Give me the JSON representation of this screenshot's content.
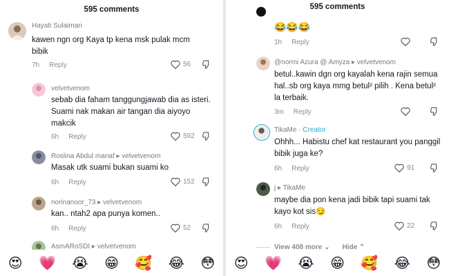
{
  "left": {
    "header": "595 comments",
    "comments": [
      {
        "user": "Hayati Sulaiman",
        "text": "kawen ngn org Kaya tp kena msk pulak mcm bibik",
        "time": "7h",
        "reply": "Reply",
        "likes": "56"
      },
      {
        "user": "velvetvenom",
        "text": "sebab dia faham tanggungjawab dia as isteri. Suami nak makan air tangan dia aiyoyo makcik",
        "time": "6h",
        "reply": "Reply",
        "likes": "592"
      },
      {
        "user": "Roslina Abdul manaf ▸ velvetvenom",
        "text": "Masak utk suami bukan suami ko",
        "time": "6h",
        "reply": "Reply",
        "likes": "152"
      },
      {
        "user": "norinanoor_73 ▸ velvetvenom",
        "text": "kan.. ntah2 apa punya komen..",
        "time": "6h",
        "reply": "Reply",
        "likes": "52"
      },
      {
        "user": "AsmARoSDI ▸ velvetvenom"
      }
    ],
    "emojis": [
      "😍",
      "💗",
      "😭",
      "😁",
      "🥰",
      "😂",
      "😳"
    ]
  },
  "right": {
    "header": "595 comments",
    "top_partial": {
      "emojis": "😂😂😂",
      "time": "1h",
      "reply": "Reply"
    },
    "comments": [
      {
        "user": "@normi Azura @ Amyza ▸ velvetvenom",
        "text": "betul..kawin dgn org kayalah kena rajin semua hal..sb org kaya mmg betul² pilih . Kena betul² la terbaik.",
        "time": "3m",
        "reply": "Reply",
        "likes": ""
      },
      {
        "user": "TikaMe",
        "badge": "· Creator",
        "text": "Ohhh... Habistu chef kat restaurant you panggil bibik juga ke?",
        "time": "6h",
        "reply": "Reply",
        "likes": "91"
      },
      {
        "user": "j ▸ TikaMe",
        "text": "maybe dia pon kena jadi bibik tapi suami tak kayo kot sis😏",
        "time": "6h",
        "reply": "Reply",
        "likes": "22"
      }
    ],
    "view_more": "View 408 more ⌄",
    "hide": "Hide ⌃",
    "emojis": [
      "😍",
      "💗",
      "😭",
      "😁",
      "🥰",
      "😂",
      "😳"
    ]
  },
  "colors": {
    "creator": "#2aa7d6",
    "muted": "#8a8b91",
    "text": "#161823"
  }
}
